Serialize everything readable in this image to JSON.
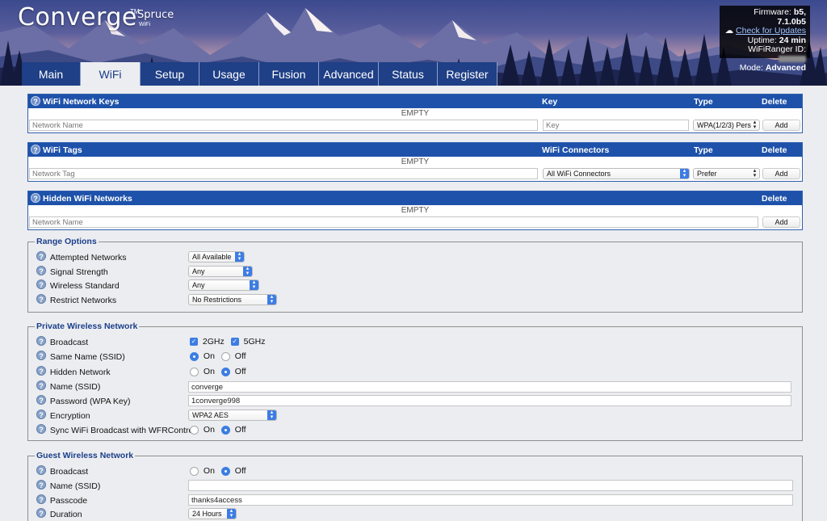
{
  "brand": {
    "name": "Converge",
    "tm": "TM",
    "model": "Spruce",
    "sub": "WiFi"
  },
  "info": {
    "firmware_label": "Firmware:",
    "firmware_value": "b5, 7.1.0b5",
    "update_link": "Check for Updates",
    "uptime_label": "Uptime:",
    "uptime_value": "24 min",
    "ranger_label": "WiFiRanger ID:",
    "mode_label": "Mode:",
    "mode_value": "Advanced"
  },
  "tabs": [
    "Main",
    "WiFi",
    "Setup",
    "Usage",
    "Fusion",
    "Advanced",
    "Status",
    "Register"
  ],
  "network_keys": {
    "title": "WiFi Network Keys",
    "col_key": "Key",
    "col_type": "Type",
    "col_delete": "Delete",
    "empty": "EMPTY",
    "name_placeholder": "Network Name",
    "key_placeholder": "Key",
    "type_value": "WPA(1/2/3) Pers",
    "add_label": "Add"
  },
  "wifi_tags": {
    "title": "WiFi Tags",
    "col_connectors": "WiFi Connectors",
    "col_type": "Type",
    "col_delete": "Delete",
    "empty": "EMPTY",
    "tag_placeholder": "Network Tag",
    "connectors_value": "All WiFi Connectors",
    "type_value": "Prefer",
    "add_label": "Add"
  },
  "hidden_networks": {
    "title": "Hidden WiFi Networks",
    "col_delete": "Delete",
    "empty": "EMPTY",
    "name_placeholder": "Network Name",
    "add_label": "Add"
  },
  "range_options": {
    "title": "Range Options",
    "attempted_label": "Attempted Networks",
    "attempted_value": "All Available",
    "signal_label": "Signal Strength",
    "signal_value": "Any",
    "standard_label": "Wireless Standard",
    "standard_value": "Any",
    "restrict_label": "Restrict Networks",
    "restrict_value": "No Restrictions"
  },
  "private_network": {
    "title": "Private Wireless Network",
    "broadcast_label": "Broadcast",
    "band_2g": "2GHz",
    "band_5g": "5GHz",
    "same_name_label": "Same Name (SSID)",
    "hidden_label": "Hidden Network",
    "ssid_label": "Name (SSID)",
    "ssid_value": "converge",
    "password_label": "Password (WPA Key)",
    "password_value": "1converge998",
    "encryption_label": "Encryption",
    "encryption_value": "WPA2 AES",
    "sync_label": "Sync WiFi Broadcast with WFRControl",
    "on": "On",
    "off": "Off"
  },
  "guest_network": {
    "title": "Guest Wireless Network",
    "broadcast_label": "Broadcast",
    "ssid_label": "Name (SSID)",
    "ssid_value": "",
    "passcode_label": "Passcode",
    "passcode_value": "thanks4access",
    "duration_label": "Duration",
    "duration_value": "24 Hours",
    "on": "On",
    "off": "Off"
  },
  "colors": {
    "header_blue": "#1e52aa",
    "tab_blue": "#1f3f86",
    "accent": "#3b7de3"
  }
}
